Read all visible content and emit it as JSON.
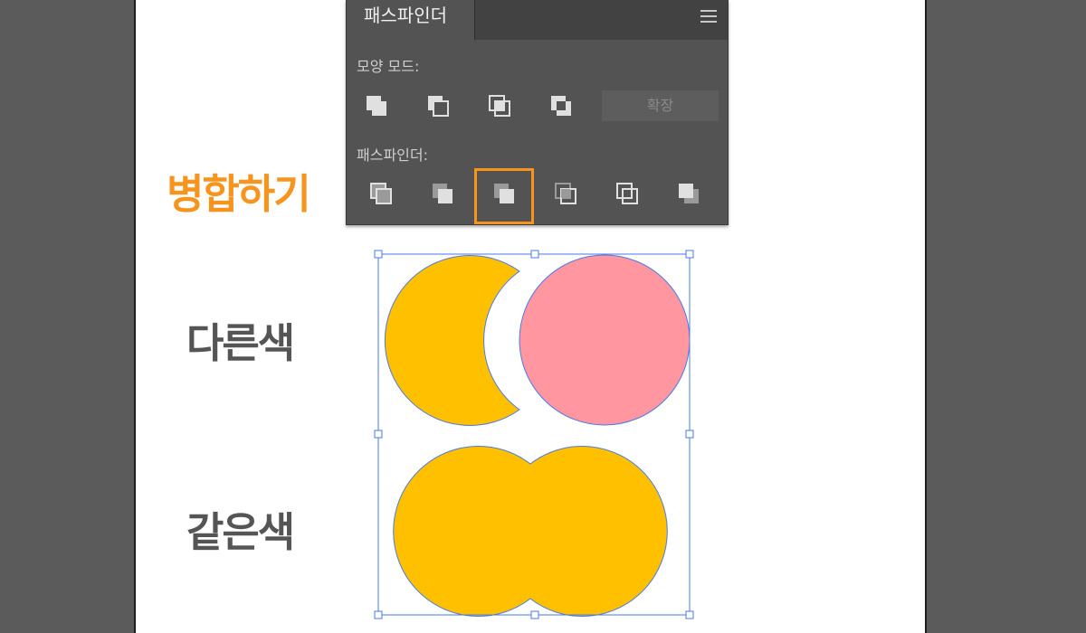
{
  "pathfinder_panel": {
    "tab_title": "패스파인더",
    "menu_icon": "hamburger-menu-icon",
    "shape_modes_label": "모양 모드:",
    "shape_modes": [
      {
        "name": "unite",
        "icon": "unite-icon"
      },
      {
        "name": "minus-front",
        "icon": "minus-front-icon"
      },
      {
        "name": "intersect",
        "icon": "intersect-icon"
      },
      {
        "name": "exclude",
        "icon": "exclude-icon"
      }
    ],
    "expand_label": "확장",
    "pathfinders_label": "패스파인더:",
    "pathfinders": [
      {
        "name": "divide",
        "icon": "divide-icon"
      },
      {
        "name": "trim",
        "icon": "trim-icon"
      },
      {
        "name": "merge",
        "icon": "merge-icon",
        "highlighted": true
      },
      {
        "name": "crop",
        "icon": "crop-icon"
      },
      {
        "name": "outline",
        "icon": "outline-icon"
      },
      {
        "name": "minus-back",
        "icon": "minus-back-icon"
      }
    ]
  },
  "annotations": {
    "merge_callout": "병합하기",
    "different_color_label": "다른색",
    "same_color_label": "같은색"
  },
  "colors": {
    "accent_orange": "#f7941d",
    "panel_bg": "#535353",
    "shape_yellow": "#ffc000",
    "shape_pink": "#ff96a0",
    "selection_blue": "#4a7ae8",
    "label_gray": "#555555"
  }
}
